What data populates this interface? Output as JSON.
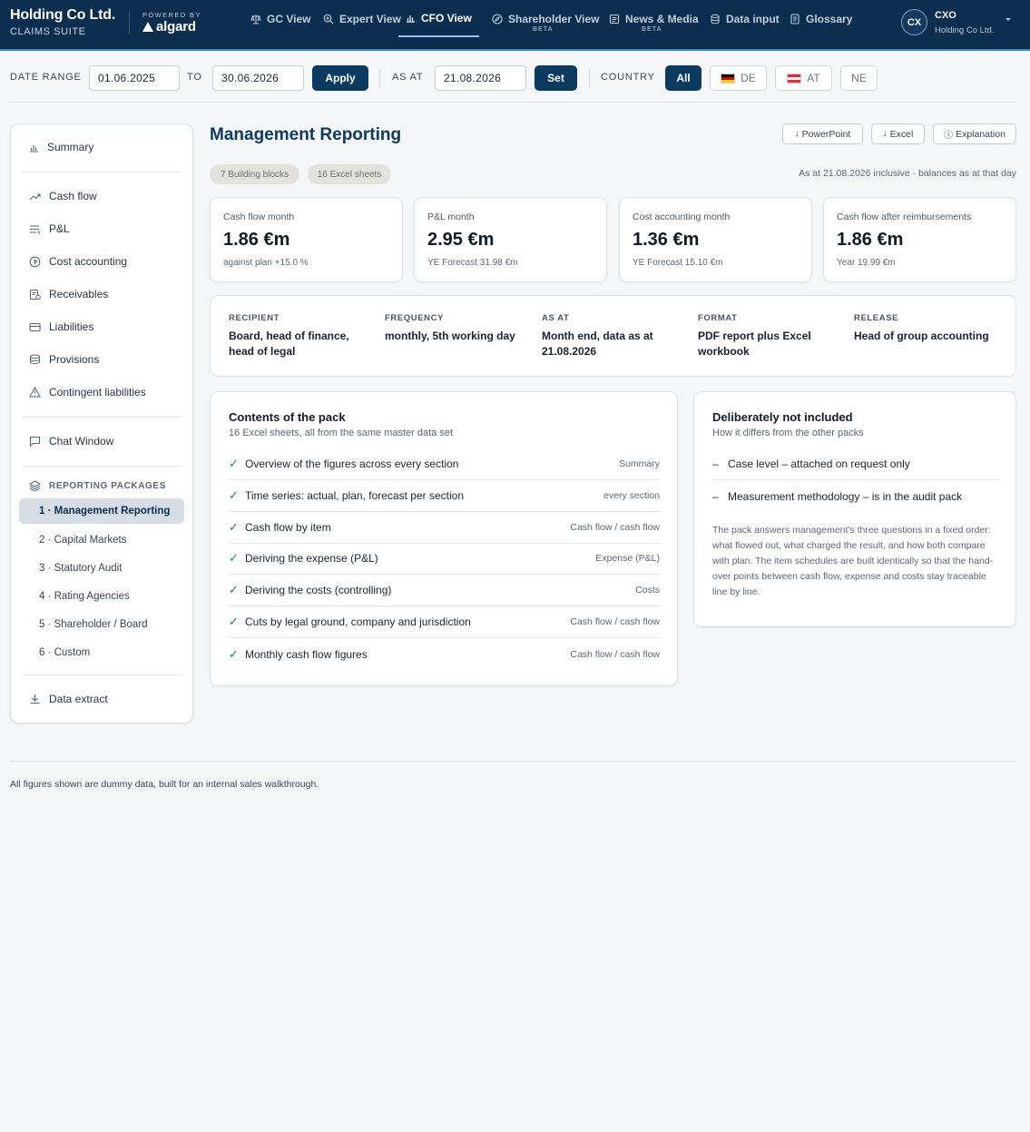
{
  "brand": {
    "title": "Holding Co Ltd.",
    "subtitle": "CLAIMS SUITE",
    "powered_by": "POWERED BY",
    "logo_text": "algard"
  },
  "nav": {
    "items": [
      {
        "label": "GC View",
        "icon": "scales-icon"
      },
      {
        "label": "Expert View",
        "icon": "magnifier-plus-icon"
      },
      {
        "label": "CFO View",
        "icon": "bar-chart-icon",
        "active": true
      },
      {
        "label": "Shareholder View",
        "icon": "compass-icon",
        "badge": "BETA"
      },
      {
        "label": "News & Media",
        "icon": "newspaper-icon",
        "badge": "BETA"
      },
      {
        "label": "Data input",
        "icon": "database-icon"
      },
      {
        "label": "Glossary",
        "icon": "book-icon"
      }
    ]
  },
  "user": {
    "initials": "CX",
    "role": "CXO",
    "company": "Holding Co Ltd."
  },
  "filters": {
    "date_range_label": "DATE RANGE",
    "date_from": "01.06.2025",
    "to_label": "TO",
    "date_to": "30.06.2026",
    "apply_label": "Apply",
    "as_at_label": "AS AT",
    "as_at_value": "21.08.2026",
    "set_label": "Set",
    "country_label": "COUNTRY",
    "countries": [
      {
        "label": "All",
        "active": true
      },
      {
        "label": "DE",
        "flag": "germany-flag"
      },
      {
        "label": "AT",
        "flag": "austria-flag"
      },
      {
        "label": "NE"
      }
    ]
  },
  "sidebar": {
    "summary": "Summary",
    "items": [
      {
        "label": "Cash flow",
        "icon": "trend-up-icon"
      },
      {
        "label": "P&L",
        "icon": "list-lines-icon"
      },
      {
        "label": "Cost accounting",
        "icon": "coin-icon"
      },
      {
        "label": "Receivables",
        "icon": "invoice-icon"
      },
      {
        "label": "Liabilities",
        "icon": "card-icon"
      },
      {
        "label": "Provisions",
        "icon": "stack-icon"
      },
      {
        "label": "Contingent liabilities",
        "icon": "warning-icon"
      }
    ],
    "chat": "Chat Window",
    "packages_heading": "REPORTING PACKAGES",
    "packages": [
      {
        "label": "1 · Management Reporting",
        "active": true
      },
      {
        "label": "2 · Capital Markets"
      },
      {
        "label": "3 · Statutory Audit"
      },
      {
        "label": "4 · Rating Agencies"
      },
      {
        "label": "5 · Shareholder / Board"
      },
      {
        "label": "6 · Custom"
      }
    ],
    "data_extract": "Data extract"
  },
  "main": {
    "title": "Management Reporting",
    "buttons": {
      "powerpoint": "PowerPoint",
      "excel": "Excel",
      "explanation": "Explanation"
    },
    "tags": [
      "7 Building blocks",
      "16 Excel sheets"
    ],
    "as_at_note": "As at 21.08.2026 inclusive · balances as at that day",
    "kpis": [
      {
        "label": "Cash flow month",
        "value": "1.86 €m",
        "sub": "against plan +15.0 %"
      },
      {
        "label": "P&L month",
        "value": "2.95 €m",
        "sub": "YE Forecast 31.98 €m"
      },
      {
        "label": "Cost accounting month",
        "value": "1.36 €m",
        "sub": "YE Forecast 15.10 €m"
      },
      {
        "label": "Cash flow after reimbursements",
        "value": "1.86 €m",
        "sub": "Year 19.99 €m"
      }
    ],
    "meta": [
      {
        "label": "RECIPIENT",
        "value": "Board, head of finance, head of legal"
      },
      {
        "label": "FREQUENCY",
        "value": "monthly, 5th working day"
      },
      {
        "label": "AS AT",
        "value": "Month end, data as at 21.08.2026"
      },
      {
        "label": "FORMAT",
        "value": "PDF report plus Excel workbook"
      },
      {
        "label": "RELEASE",
        "value": "Head of group accounting"
      }
    ],
    "contents": {
      "title": "Contents of the pack",
      "subtitle": "16 Excel sheets, all from the same master data set",
      "rows": [
        {
          "text": "Overview of the figures across every section",
          "meta": "Summary"
        },
        {
          "text": "Time series: actual, plan, forecast per section",
          "meta": "every section"
        },
        {
          "text": "Cash flow by item",
          "meta": "Cash flow / cash flow"
        },
        {
          "text": "Deriving the expense (P&L)",
          "meta": "Expense (P&L)"
        },
        {
          "text": "Deriving the costs (controlling)",
          "meta": "Costs"
        },
        {
          "text": "Cuts by legal ground, company and jurisdiction",
          "meta": "Cash flow / cash flow"
        },
        {
          "text": "Monthly cash flow figures",
          "meta": "Cash flow / cash flow"
        }
      ]
    },
    "excluded": {
      "title": "Deliberately not included",
      "subtitle": "How it differs from the other packs",
      "rows": [
        "Case level – attached on request only",
        "Measurement methodology – is in the audit pack"
      ],
      "paragraph": "The pack answers management's three questions in a fixed order: what flowed out, what charged the result, and how both compare with plan. The item schedules are built identically so that the hand-over points between cash flow, expense and costs stay traceable line by line."
    }
  },
  "footer": {
    "note": "All figures shown are dummy data, built for an internal sales walkthrough."
  },
  "colors": {
    "navy": "#0b2e4f",
    "accent": "#0b3a60",
    "check": "#1e8a4c"
  }
}
